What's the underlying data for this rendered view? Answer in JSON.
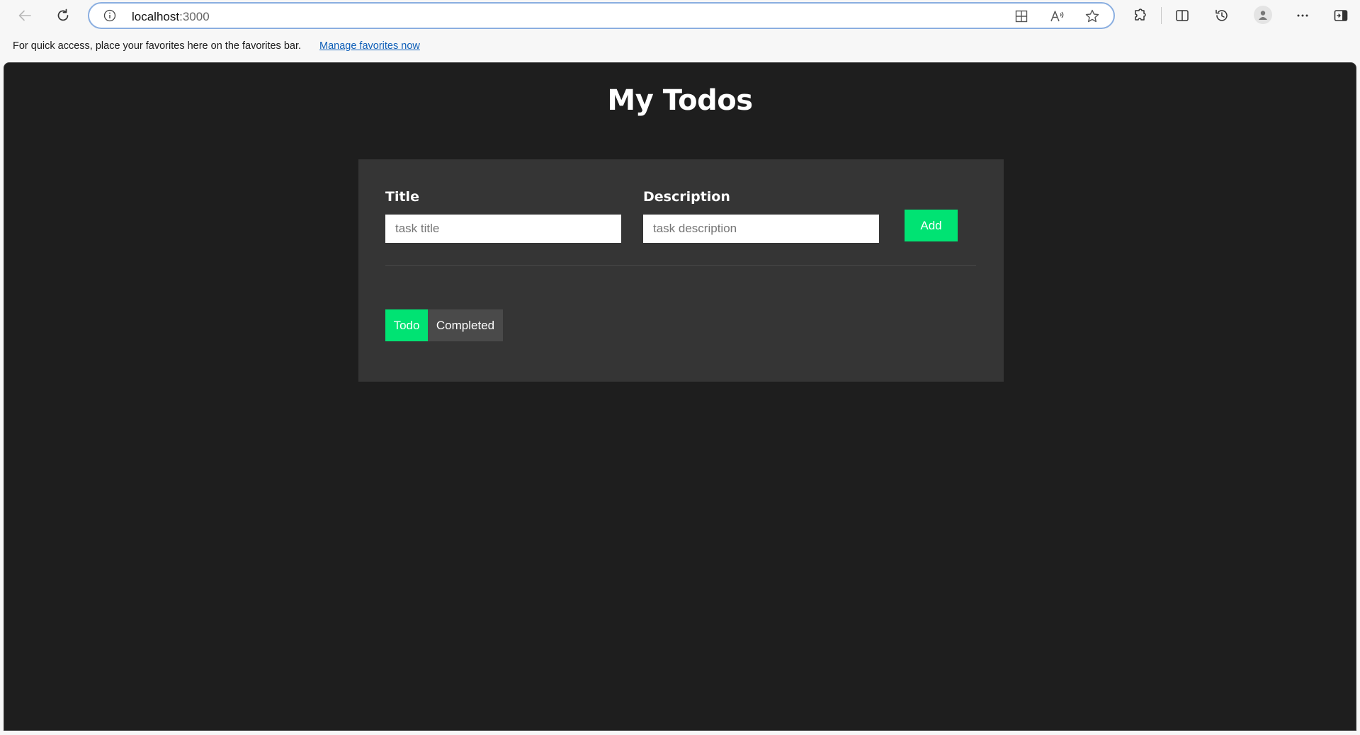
{
  "browser": {
    "address": {
      "host": "localhost",
      "port": ":3000"
    },
    "favorites_bar": {
      "message": "For quick access, place your favorites here on the favorites bar.",
      "link_label": "Manage favorites now"
    }
  },
  "page": {
    "title": "My Todos",
    "form": {
      "title_label": "Title",
      "title_placeholder": "task title",
      "title_value": "",
      "description_label": "Description",
      "description_placeholder": "task description",
      "description_value": "",
      "add_label": "Add"
    },
    "tabs": [
      {
        "label": "Todo",
        "active": true
      },
      {
        "label": "Completed",
        "active": false
      }
    ]
  },
  "colors": {
    "accent": "#00e373",
    "page_background": "#1e1e1e",
    "card_background": "#353535"
  },
  "icons": {
    "toolbar": [
      "back-arrow-icon",
      "refresh-icon",
      "info-icon",
      "app-available-icon",
      "read-aloud-icon",
      "favorite-star-icon",
      "extensions-icon",
      "split-screen-icon",
      "history-icon",
      "profile-icon",
      "more-icon",
      "sidebar-icon"
    ]
  }
}
